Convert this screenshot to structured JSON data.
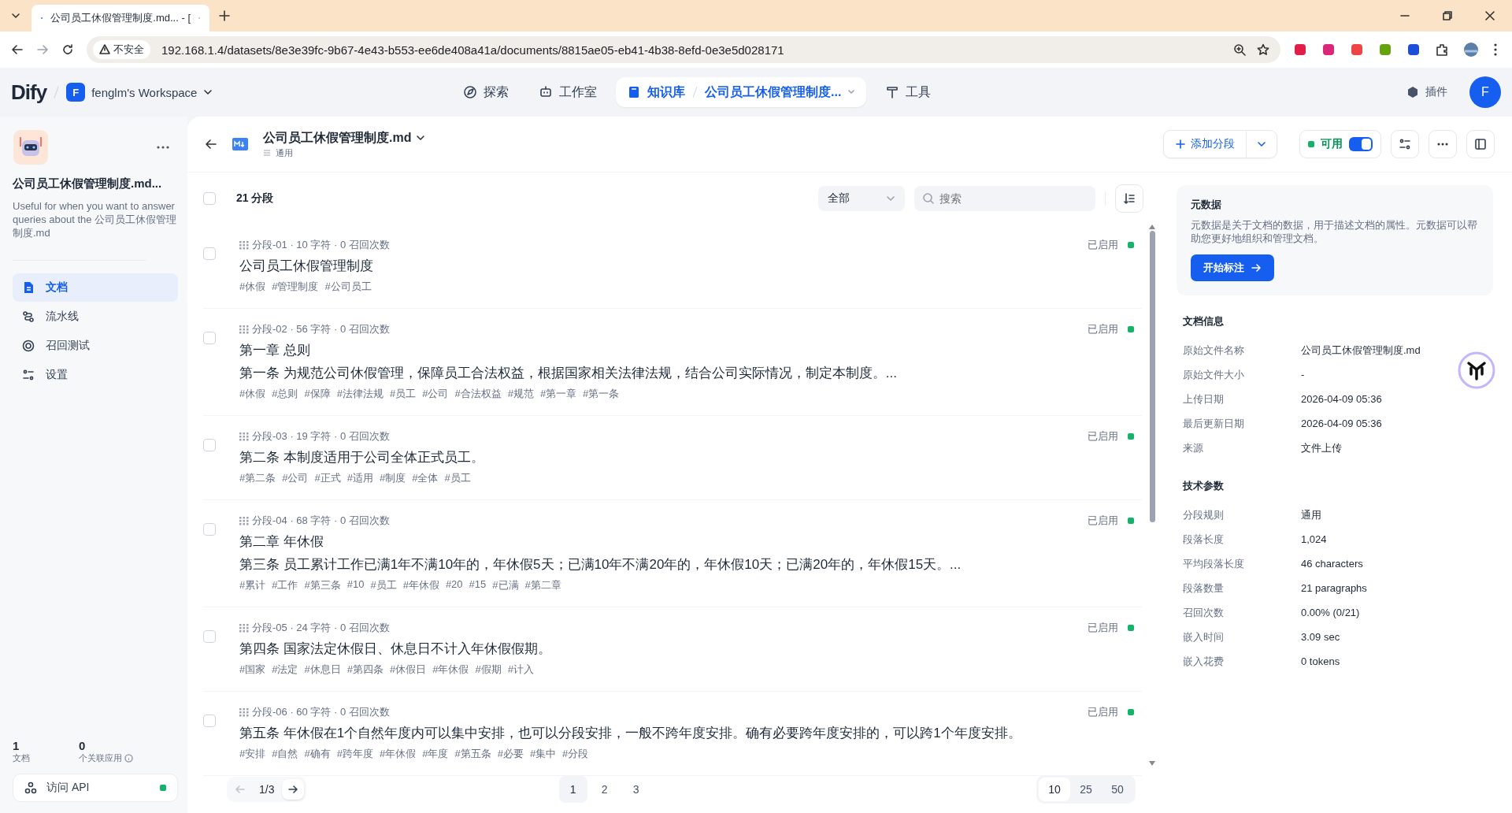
{
  "browser": {
    "tab_title": "公司员工休假管理制度.md... - [",
    "address_warning": "不安全",
    "url": "192.168.1.4/datasets/8e3e39fc-9b67-4e43-b553-ee6de408a41a/documents/8815ae05-eb41-4b38-8efd-0e3e5d028171"
  },
  "app_header": {
    "logo": "Dify",
    "workspace": {
      "initial": "F",
      "name": "fenglm's Workspace"
    },
    "nav": [
      {
        "label": "探索",
        "selected": false
      },
      {
        "label": "工作室",
        "selected": false
      },
      {
        "label": "知识库",
        "selected": true,
        "crumb": "公司员工休假管理制度..."
      },
      {
        "label": "工具",
        "selected": false
      }
    ],
    "plugins": "插件",
    "avatar": "F"
  },
  "sidebar": {
    "dataset_name": "公司员工休假管理制度.md...",
    "description": "Useful for when you want to answer queries about the 公司员工休假管理制度.md",
    "menu": [
      {
        "label": "文档",
        "selected": true
      },
      {
        "label": "流水线",
        "selected": false
      },
      {
        "label": "召回测试",
        "selected": false
      },
      {
        "label": "设置",
        "selected": false
      }
    ],
    "stats": [
      {
        "value": "1",
        "label": "文档"
      },
      {
        "value": "0",
        "label": "个关联应用"
      }
    ],
    "api": {
      "label": "访问 API",
      "on": true
    }
  },
  "document": {
    "title": "公司员工休假管理制度.md",
    "mode": "通用",
    "add_segment": "添加分段",
    "availability": {
      "label": "可用",
      "on": true
    }
  },
  "toolbar": {
    "checked": false,
    "count": "21 分段",
    "filter": "全部",
    "search_placeholder": "搜索"
  },
  "segments": [
    {
      "checked": false,
      "meta": "分段-01 · 10 字符 · 0 召回次数",
      "status": "已启用",
      "enabled": true,
      "lines": [
        "公司员工休假管理制度"
      ],
      "keywords": [
        "#休假",
        "#管理制度",
        "#公司员工"
      ]
    },
    {
      "checked": false,
      "meta": "分段-02 · 56 字符 · 0 召回次数",
      "status": "已启用",
      "enabled": true,
      "lines": [
        "第一章 总则",
        "第一条 为规范公司休假管理，保障员工合法权益，根据国家相关法律法规，结合公司实际情况，制定本制度。..."
      ],
      "keywords": [
        "#休假",
        "#总则",
        "#保障",
        "#法律法规",
        "#员工",
        "#公司",
        "#合法权益",
        "#规范",
        "#第一章",
        "#第一条"
      ]
    },
    {
      "checked": false,
      "meta": "分段-03 · 19 字符 · 0 召回次数",
      "status": "已启用",
      "enabled": true,
      "lines": [
        "第二条 本制度适用于公司全体正式员工。"
      ],
      "keywords": [
        "#第二条",
        "#公司",
        "#正式",
        "#适用",
        "#制度",
        "#全体",
        "#员工"
      ]
    },
    {
      "checked": false,
      "meta": "分段-04 · 68 字符 · 0 召回次数",
      "status": "已启用",
      "enabled": true,
      "lines": [
        "第二章 年休假",
        "第三条 员工累计工作已满1年不满10年的，年休假5天；已满10年不满20年的，年休假10天；已满20年的，年休假15天。..."
      ],
      "keywords": [
        "#累计",
        "#工作",
        "#第三条",
        "#10",
        "#员工",
        "#年休假",
        "#20",
        "#15",
        "#已满",
        "#第二章"
      ]
    },
    {
      "checked": false,
      "meta": "分段-05 · 24 字符 · 0 召回次数",
      "status": "已启用",
      "enabled": true,
      "lines": [
        "第四条 国家法定休假日、休息日不计入年休假假期。"
      ],
      "keywords": [
        "#国家",
        "#法定",
        "#休息日",
        "#第四条",
        "#休假日",
        "#年休假",
        "#假期",
        "#计入"
      ]
    },
    {
      "checked": false,
      "meta": "分段-06 · 60 字符 · 0 召回次数",
      "status": "已启用",
      "enabled": true,
      "lines": [
        "第五条 年休假在1个自然年度内可以集中安排，也可以分段安排，一般不跨年度安排。确有必要跨年度安排的，可以跨1个年度安排。"
      ],
      "keywords": [
        "#安排",
        "#自然",
        "#确有",
        "#跨年度",
        "#年休假",
        "#年度",
        "#第五条",
        "#必要",
        "#集中",
        "#分段"
      ]
    }
  ],
  "pagination": {
    "page": "1/3",
    "pages": [
      {
        "label": "1",
        "selected": true
      },
      {
        "label": "2",
        "selected": false
      },
      {
        "label": "3",
        "selected": false
      }
    ],
    "sizes": [
      {
        "label": "10",
        "selected": true
      },
      {
        "label": "25",
        "selected": false
      },
      {
        "label": "50",
        "selected": false
      }
    ]
  },
  "metadata": {
    "title": "元数据",
    "description": "元数据是关于文档的数据，用于描述文档的属性。元数据可以帮助您更好地组织和管理文档。",
    "button": "开始标注"
  },
  "doc_info": {
    "title": "文档信息",
    "rows": [
      {
        "label": "原始文件名称",
        "value": "公司员工休假管理制度.md"
      },
      {
        "label": "原始文件大小",
        "value": "-"
      },
      {
        "label": "上传日期",
        "value": "2026-04-09 05:36"
      },
      {
        "label": "最后更新日期",
        "value": "2026-04-09 05:36"
      },
      {
        "label": "来源",
        "value": "文件上传"
      }
    ]
  },
  "tech_params": {
    "title": "技术参数",
    "rows": [
      {
        "label": "分段规则",
        "value": "通用"
      },
      {
        "label": "段落长度",
        "value": "1,024"
      },
      {
        "label": "平均段落长度",
        "value": "46 characters"
      },
      {
        "label": "段落数量",
        "value": "21 paragraphs"
      },
      {
        "label": "召回次数",
        "value": "0.00% (0/21)"
      },
      {
        "label": "嵌入时间",
        "value": "3.09 sec"
      },
      {
        "label": "嵌入花费",
        "value": "0 tokens"
      }
    ]
  }
}
